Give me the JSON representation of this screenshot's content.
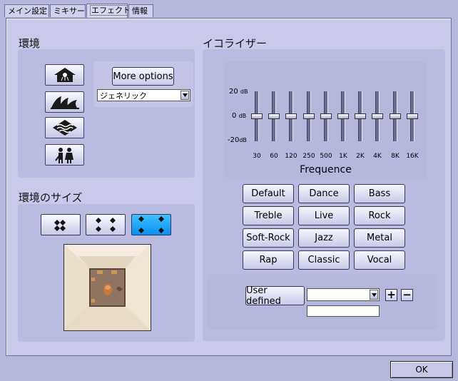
{
  "tabs": [
    {
      "label": "メイン設定"
    },
    {
      "label": "ミキサー"
    },
    {
      "label": "エフェクト"
    },
    {
      "label": "情報"
    }
  ],
  "environment": {
    "title": "環境",
    "more_options_label": "More options",
    "preset_value": "ジェネリック",
    "icons": [
      "house-shower-icon",
      "opera-house-icon",
      "waves-icon",
      "people-icon"
    ]
  },
  "environment_size": {
    "title": "環境のサイズ",
    "sizes": [
      "small-room-icon",
      "medium-room-icon",
      "large-room-icon"
    ],
    "selected_index": 2
  },
  "equalizer": {
    "title": "イコライザー",
    "db_labels": {
      "top": "20",
      "mid": "0",
      "bottom": "-20",
      "unit": "dB"
    },
    "bands": [
      "30",
      "60",
      "120",
      "250",
      "500",
      "1K",
      "2K",
      "4K",
      "8K",
      "16K"
    ],
    "band_values_db": [
      0,
      0,
      0,
      0,
      0,
      0,
      0,
      0,
      0,
      0
    ],
    "frequence_label": "Frequence",
    "presets": [
      "Default",
      "Dance",
      "Bass",
      "Treble",
      "Live",
      "Rock",
      "Soft-Rock",
      "Jazz",
      "Metal",
      "Rap",
      "Classic",
      "Vocal"
    ],
    "user_defined_label": "User defined",
    "user_defined_value": "",
    "name_field_value": "",
    "add_label": "+",
    "remove_label": "−"
  },
  "footer": {
    "ok_label": "OK"
  },
  "colors": {
    "background": "#b6b7dc",
    "panel": "#babbe0",
    "selected": "#1fa6ff"
  }
}
